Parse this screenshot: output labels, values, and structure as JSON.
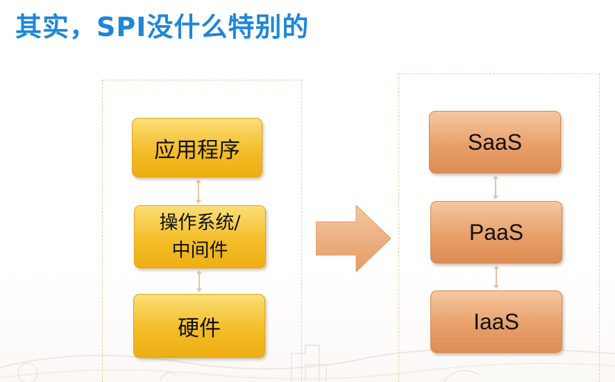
{
  "title": "其实，SPI没什么特别的",
  "left_stack": {
    "application": "应用程序",
    "os_line1": "操作系统/",
    "os_line2": "中间件",
    "hardware": "硬件"
  },
  "right_stack": {
    "saas": "SaaS",
    "paas": "PaaS",
    "iaas": "IaaS"
  },
  "colors": {
    "title": "#1f86d8",
    "left_box": "#f4bd2a",
    "right_box": "#e8a06a",
    "arrow": "#e9a773",
    "frame": "#f1c6a0"
  }
}
